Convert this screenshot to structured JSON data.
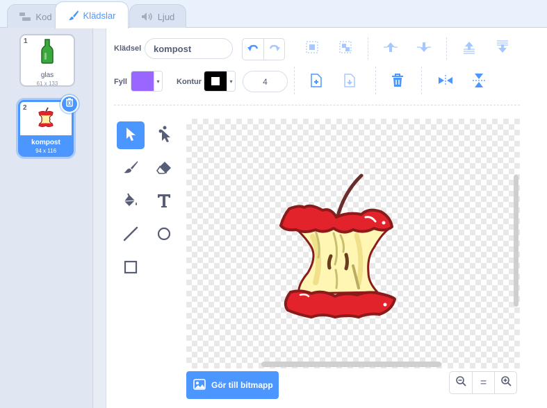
{
  "tabs": [
    {
      "label": "Kod",
      "icon": "code-blocks-icon"
    },
    {
      "label": "Klädslar",
      "icon": "paintbrush-icon"
    },
    {
      "label": "Ljud",
      "icon": "speaker-icon"
    }
  ],
  "costumes": [
    {
      "number": "1",
      "name": "glas",
      "size": "61 x 133",
      "icon": "green-bottle-icon"
    },
    {
      "number": "2",
      "name": "kompost",
      "size": "94 x 116",
      "icon": "apple-core-icon"
    }
  ],
  "toolbar": {
    "costume_label": "Klädsel",
    "costume_name": "kompost",
    "fill_label": "Fyll",
    "fill_color": "#9966ff",
    "outline_label": "Kontur",
    "outline_color": "#000000",
    "outline_width": "4"
  },
  "footer": {
    "bitmap_button": "Gör till bitmapp",
    "zoom_reset": "="
  },
  "colors": {
    "accent": "#4c97ff",
    "apple_red": "#e3232b",
    "apple_outline": "#8b1a1a",
    "core_yellow": "#fff6b3"
  }
}
